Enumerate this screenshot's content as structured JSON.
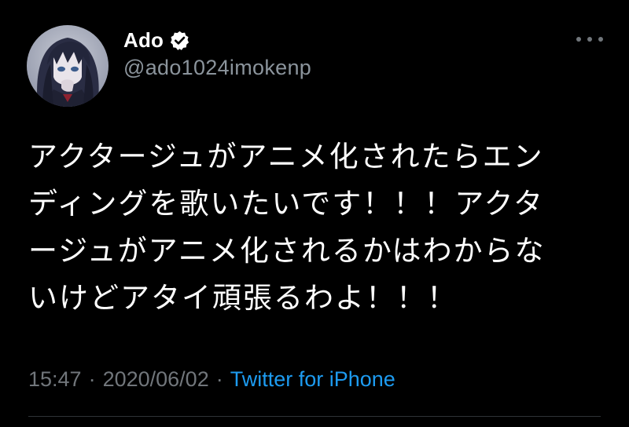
{
  "author": {
    "display_name": "Ado",
    "handle": "@ado1024imokenp",
    "verified_icon": "verified-badge-icon",
    "avatar_icon": "avatar-illustration"
  },
  "tweet": {
    "lines": [
      "アクタージュがアニメ化されたらエン",
      "ディングを歌いたいです！！！アクタ",
      "ージュがアニメ化されるかはわからな",
      "いけどアタイ頑張るわよ！！！"
    ]
  },
  "meta": {
    "time": "15:47",
    "separator_1": "·",
    "date": "2020/06/02",
    "separator_2": "·",
    "source": "Twitter for iPhone"
  },
  "menu": {
    "icon": "more-options-icon"
  },
  "colors": {
    "background": "#000000",
    "text_primary": "#ffffff",
    "text_secondary": "#71767b",
    "link": "#1d9bf0",
    "divider": "#2f3336"
  }
}
